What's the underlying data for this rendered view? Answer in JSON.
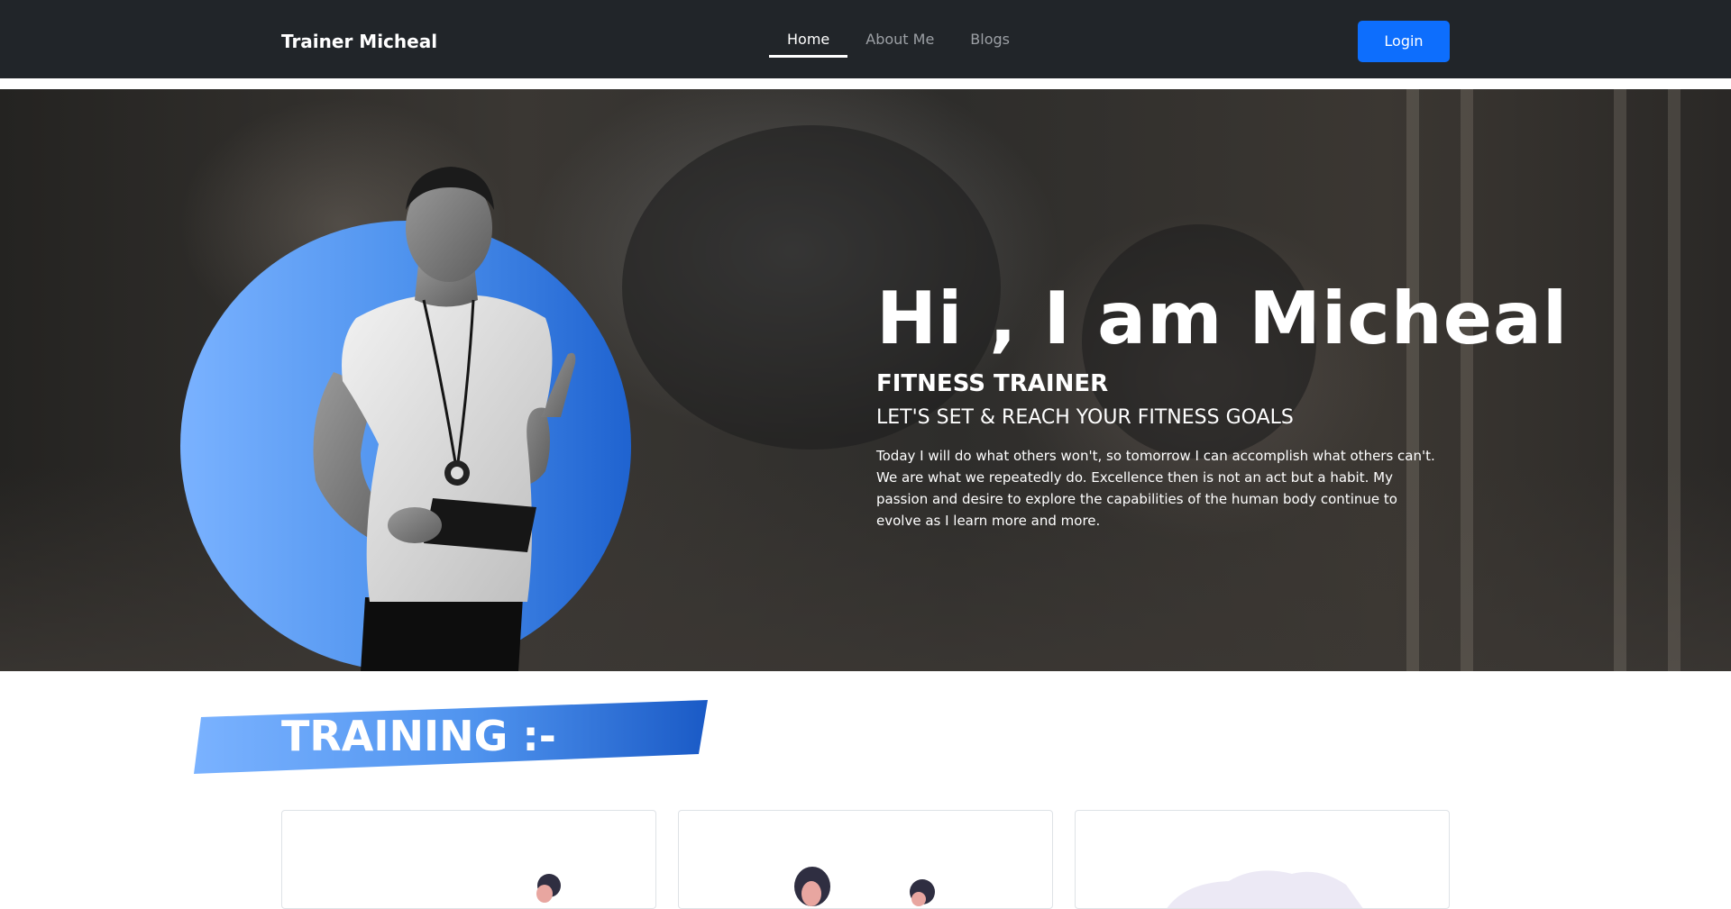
{
  "navbar": {
    "brand": "Trainer Micheal",
    "links": [
      {
        "label": "Home",
        "active": true
      },
      {
        "label": "About Me",
        "active": false
      },
      {
        "label": "Blogs",
        "active": false
      }
    ],
    "login_label": "Login"
  },
  "hero": {
    "title": "Hi , I am Micheal",
    "subtitle": "FITNESS TRAINER",
    "tagline": "LET'S SET & REACH YOUR FITNESS GOALS",
    "description": "Today I will do what others won't, so tomorrow I can accomplish what others can't. We are what we repeatedly do. Excellence then is not an act but a habit. My passion and desire to explore the capabilities of the human body continue to evolve as I learn more and more."
  },
  "training": {
    "heading": "TRAINING :-"
  },
  "colors": {
    "navbar_bg": "#212529",
    "accent": "#0d6efd",
    "circle_light": "#7ab2ff",
    "circle_dark": "#1f63d0"
  },
  "icons": [
    "trainer-photo",
    "training-card-illustration"
  ]
}
